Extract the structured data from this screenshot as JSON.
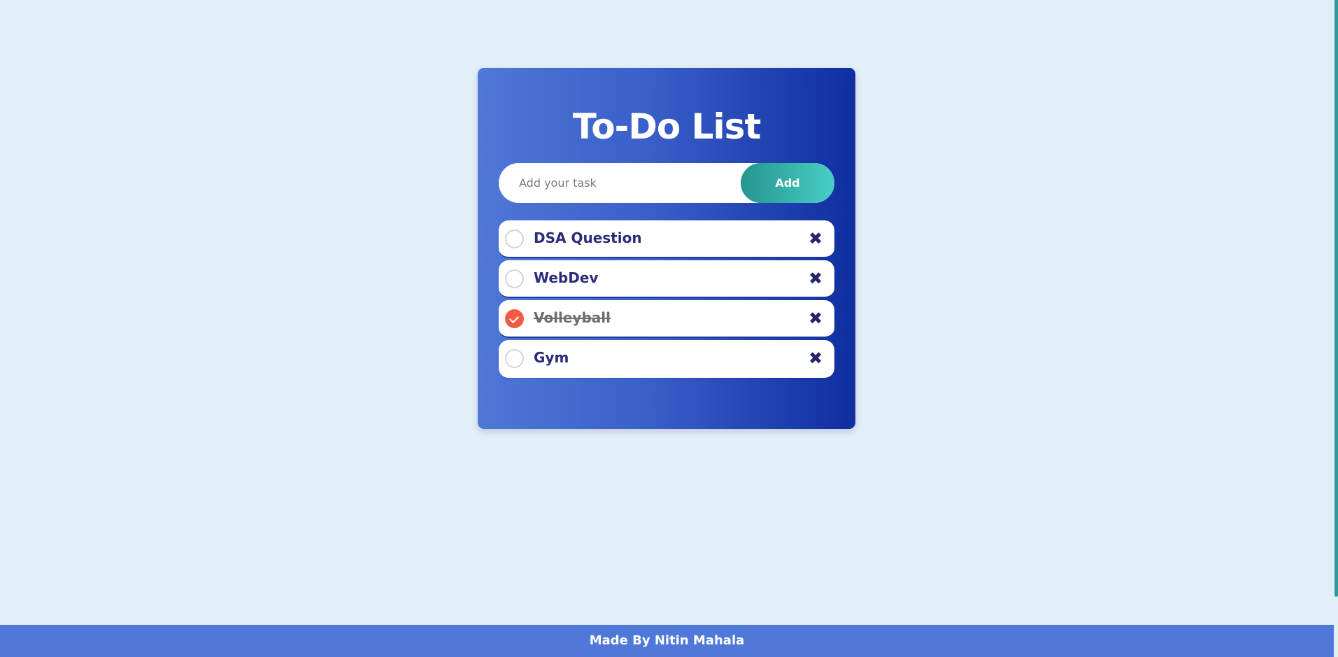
{
  "app": {
    "title": "To-Do List"
  },
  "input": {
    "placeholder": "Add your task",
    "value": "",
    "add_label": "Add"
  },
  "tasks": [
    {
      "label": "DSA Question",
      "completed": false,
      "delete_icon": "close-icon"
    },
    {
      "label": "WebDev",
      "completed": false,
      "delete_icon": "close-icon"
    },
    {
      "label": "Volleyball",
      "completed": true,
      "delete_icon": "close-icon"
    },
    {
      "label": "Gym",
      "completed": false,
      "delete_icon": "close-icon"
    }
  ],
  "footer": {
    "text": "Made By Nitin Mahala"
  },
  "colors": {
    "background": "#e3eff8",
    "card_gradient_start": "#4f78d8",
    "card_gradient_end": "#0f2ea0",
    "add_button_start": "#26948f",
    "add_button_end": "#49cfc5",
    "checked": "#ef5b45",
    "task_text": "#2b2b7a",
    "footer": "#4f78d8"
  }
}
